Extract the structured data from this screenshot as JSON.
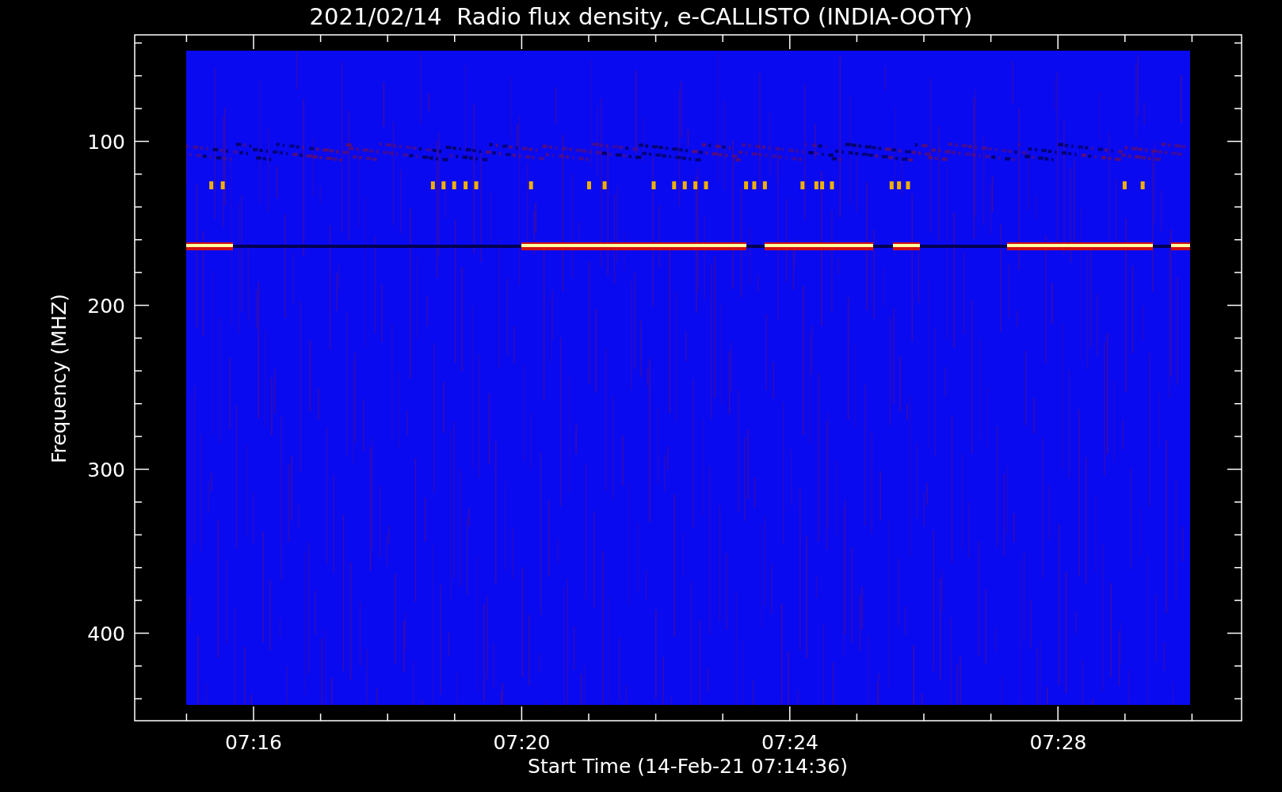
{
  "title": "2021/02/14  Radio flux density, e-CALLISTO (INDIA-OOTY)",
  "y_axis": {
    "label": "Frequency (MHZ)",
    "ticks": [
      "100",
      "200",
      "300",
      "400"
    ]
  },
  "x_axis": {
    "label": "Start Time (14-Feb-21 07:14:36)",
    "ticks": [
      "07:16",
      "07:20",
      "07:24",
      "07:28"
    ]
  }
}
